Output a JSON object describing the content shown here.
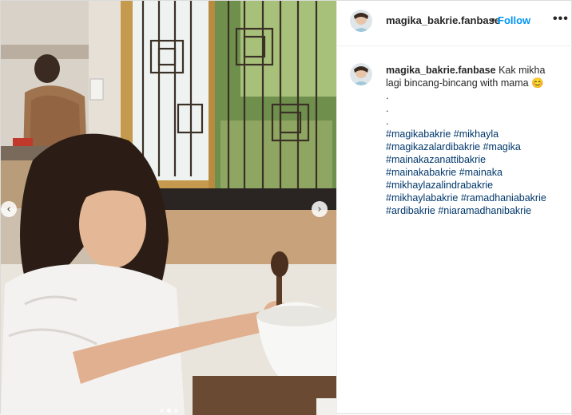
{
  "post": {
    "username": "magika_bakrie.fanbase",
    "separator": "•",
    "follow_label": "Follow",
    "more_icon": "more-options-icon",
    "more_label": "•••"
  },
  "carousel": {
    "prev_icon": "chevron-left-icon",
    "next_icon": "chevron-right-icon",
    "prev_glyph": "‹",
    "next_glyph": "›",
    "slide_count": 3,
    "active_index": 1
  },
  "caption": {
    "username": "magika_bakrie.fanbase",
    "text_first": "Kak mikha",
    "text_second": "lagi bincang-bincang with mama",
    "emoji": "😊",
    "dots": [
      ".",
      ".",
      "."
    ],
    "hashtag_lines": [
      [
        "#magikabakrie",
        "#mikhayla"
      ],
      [
        "#magikazalardibakrie",
        "#magika"
      ],
      [
        "#mainakazanattibakrie"
      ],
      [
        "#mainakabakrie",
        "#mainaka"
      ],
      [
        "#mikhaylazalindrabakrie"
      ],
      [
        "#mikhaylabakrie",
        "#ramadhaniabakrie"
      ],
      [
        "#ardibakrie",
        "#niaramadhanibakrie"
      ]
    ]
  },
  "colors": {
    "link": "#00376b",
    "follow": "#0095f6",
    "text": "#262626"
  }
}
